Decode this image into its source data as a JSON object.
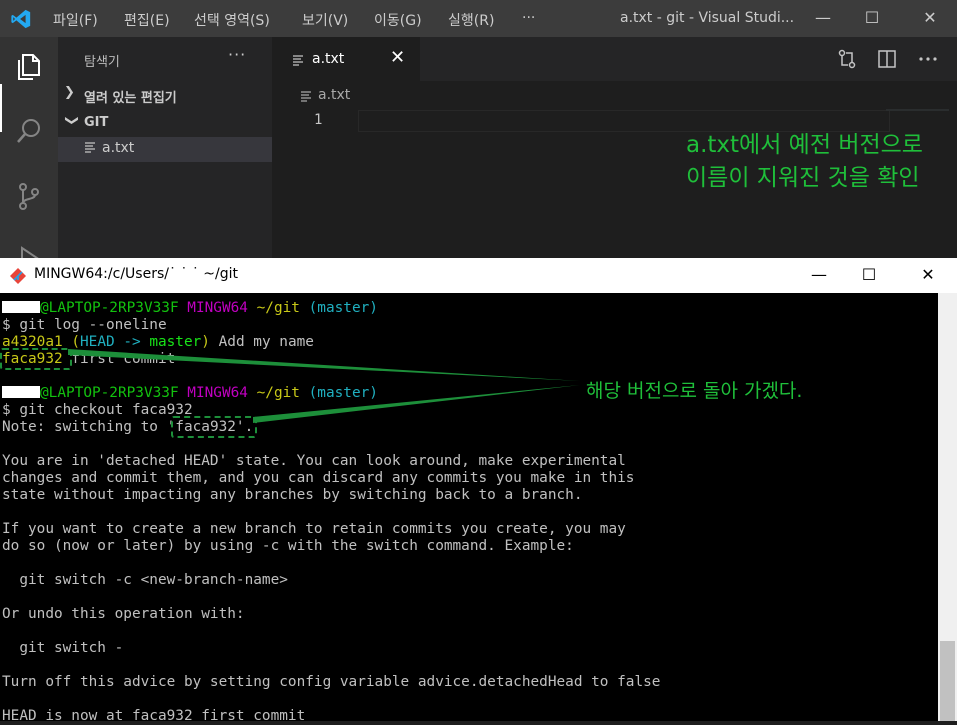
{
  "vscode": {
    "menu": [
      "파일(F)",
      "편집(E)",
      "선택 영역(S)",
      "보기(V)",
      "이동(G)",
      "실행(R)",
      "···"
    ],
    "window_title": "a.txt - git - Visual Studi...",
    "controls": {
      "minimize": "—",
      "maximize": "☐",
      "close": "✕"
    },
    "sidebar": {
      "title": "탐색기",
      "more": "···",
      "open_editors_label": "열려 있는 편집기",
      "folder_label": "GIT",
      "file": "a.txt"
    },
    "tab": {
      "name": "a.txt",
      "close": "✕"
    },
    "breadcrumb": "a.txt",
    "line_number": "1",
    "annotation_lines": [
      "a.txt에서 예전 버전으로",
      "이름이 지워진 것을 확인"
    ]
  },
  "terminal": {
    "title": "MINGW64:/c/Users/˙ ˙ ˙ ~/git",
    "controls": {
      "minimize": "—",
      "maximize": "☐",
      "close": "✕"
    },
    "prompt1": {
      "host": "@LAPTOP-2RP3V33F",
      "shell": "MINGW64",
      "path": "~/git",
      "branch": "(master)"
    },
    "cmd1": "$ git log --oneline",
    "log": {
      "hash1": "a4320a1",
      "refs_open": "(",
      "head": "HEAD -> ",
      "branch": "master",
      "refs_close": ")",
      "msg1": " Add my name",
      "hash2": "faca932",
      "msg2": " first commit"
    },
    "prompt2": {
      "host": "@LAPTOP-2RP3V33F",
      "shell": "MINGW64",
      "path": "~/git",
      "branch": "(master)"
    },
    "cmd2": "$ git checkout faca932",
    "note_prefix": "Note: switching to ",
    "note_hash": "'faca932'",
    "note_suffix": ".",
    "lines": [
      "You are in 'detached HEAD' state. You can look around, make experimental",
      "changes and commit them, and you can discard any commits you make in this",
      "state without impacting any branches by switching back to a branch.",
      "If you want to create a new branch to retain commits you create, you may",
      "do so (now or later) by using -c with the switch command. Example:",
      "  git switch -c <new-branch-name>",
      "Or undo this operation with:",
      "  git switch -",
      "Turn off this advice by setting config variable advice.detachedHead to false",
      "HEAD is now at faca932 first commit"
    ],
    "annotation": "해당 버전으로 돌아 가겠다."
  }
}
